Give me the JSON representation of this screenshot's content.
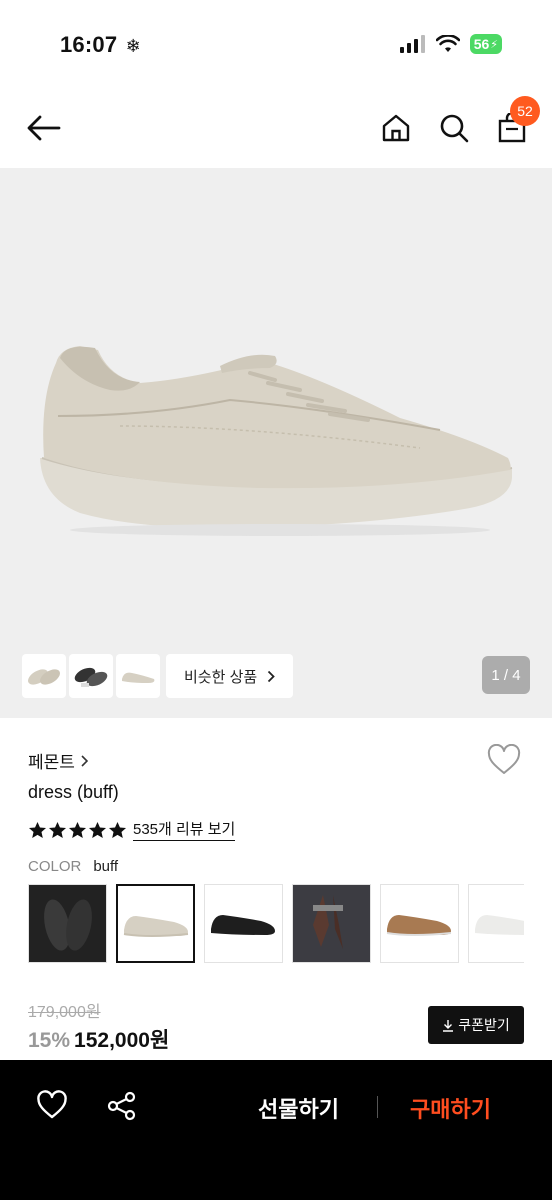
{
  "status_bar": {
    "time": "16:07",
    "battery": "56"
  },
  "nav": {
    "cart_count": "52"
  },
  "gallery": {
    "similar_label": "비슷한 상품",
    "page_indicator": "1 / 4"
  },
  "product": {
    "brand": "페몬트",
    "name": "dress (buff)",
    "rating_stars": 5,
    "review_link": "535개 리뷰 보기",
    "color_label": "COLOR",
    "color_value": "buff",
    "swatches": [
      "black",
      "buff",
      "black-2",
      "brown",
      "tan",
      "white"
    ],
    "original_price": "179,000원",
    "discount": "15%",
    "sale_price": "152,000원",
    "coupon_label": "쿠폰받기"
  },
  "bottom_bar": {
    "gift_label": "선물하기",
    "buy_label": "구매하기"
  },
  "colors": {
    "accent": "#ff4d1f",
    "badge": "#ff5a1f",
    "hero_bg": "#efefef",
    "battery": "#4cd964"
  }
}
